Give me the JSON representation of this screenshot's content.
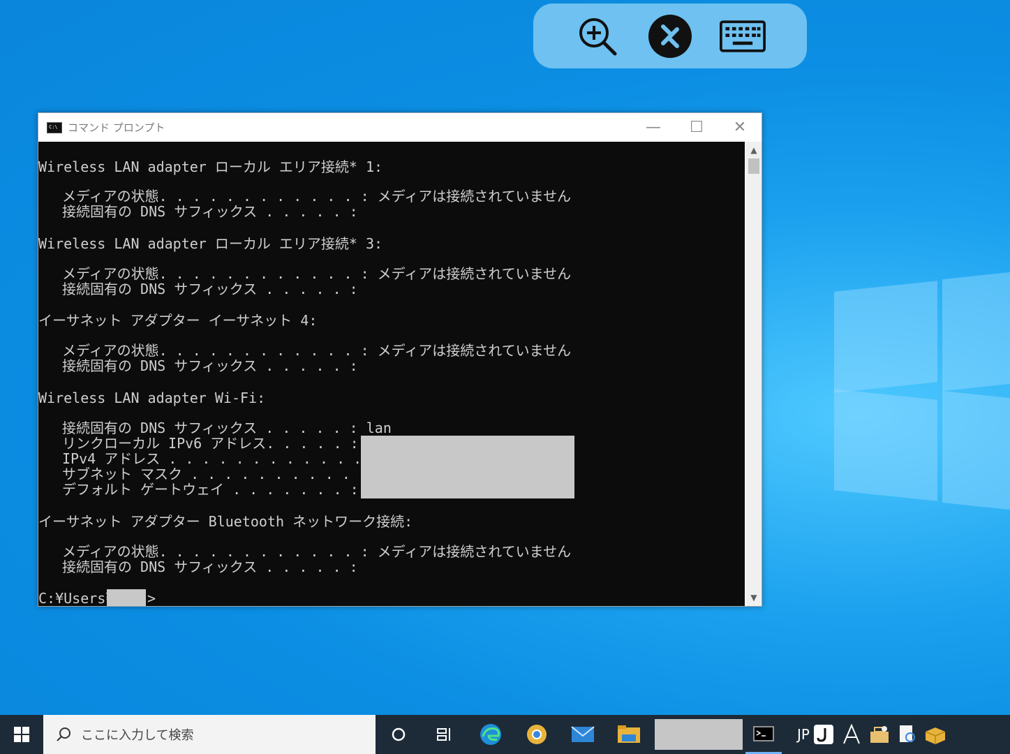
{
  "window": {
    "title": "コマンド プロンプト",
    "minimize": "—",
    "maximize": "☐",
    "close": "✕"
  },
  "console": {
    "lines": [
      "Wireless LAN adapter ローカル エリア接続* 1:",
      "メディアの状態. . . . . . . . . . . . : メディアは接続されていません",
      "接続固有の DNS サフィックス . . . . . :",
      "Wireless LAN adapter ローカル エリア接続* 3:",
      "メディアの状態. . . . . . . . . . . . : メディアは接続されていません",
      "接続固有の DNS サフィックス . . . . . :",
      "イーサネット アダプター イーサネット 4:",
      "メディアの状態. . . . . . . . . . . . : メディアは接続されていません",
      "接続固有の DNS サフィックス . . . . . :",
      "Wireless LAN adapter Wi-Fi:",
      "接続固有の DNS サフィックス . . . . . : lan",
      "リンクローカル IPv6 アドレス. . . . . :",
      "IPv4 アドレス . . . . . . . . . . . . :",
      "サブネット マスク . . . . . . . . . . :",
      "デフォルト ゲートウェイ . . . . . . . :",
      "イーサネット アダプター Bluetooth ネットワーク接続:",
      "メディアの状態. . . . . . . . . . . . : メディアは接続されていません",
      "接続固有の DNS サフィックス . . . . . :",
      "C:¥Users¥",
      ">"
    ]
  },
  "taskbar": {
    "search_placeholder": "ここに入力して検索",
    "language": "JP"
  },
  "toolbar": {
    "icons": [
      "zoom-in-icon",
      "remote-desktop-icon",
      "keyboard-icon"
    ]
  },
  "colors": {
    "desktop": "#0b8ee3",
    "console_bg": "#0c0c0c",
    "console_text": "#cfcfcf",
    "taskbar": "#1d2b38",
    "toolbar": "#6ec1f0"
  }
}
